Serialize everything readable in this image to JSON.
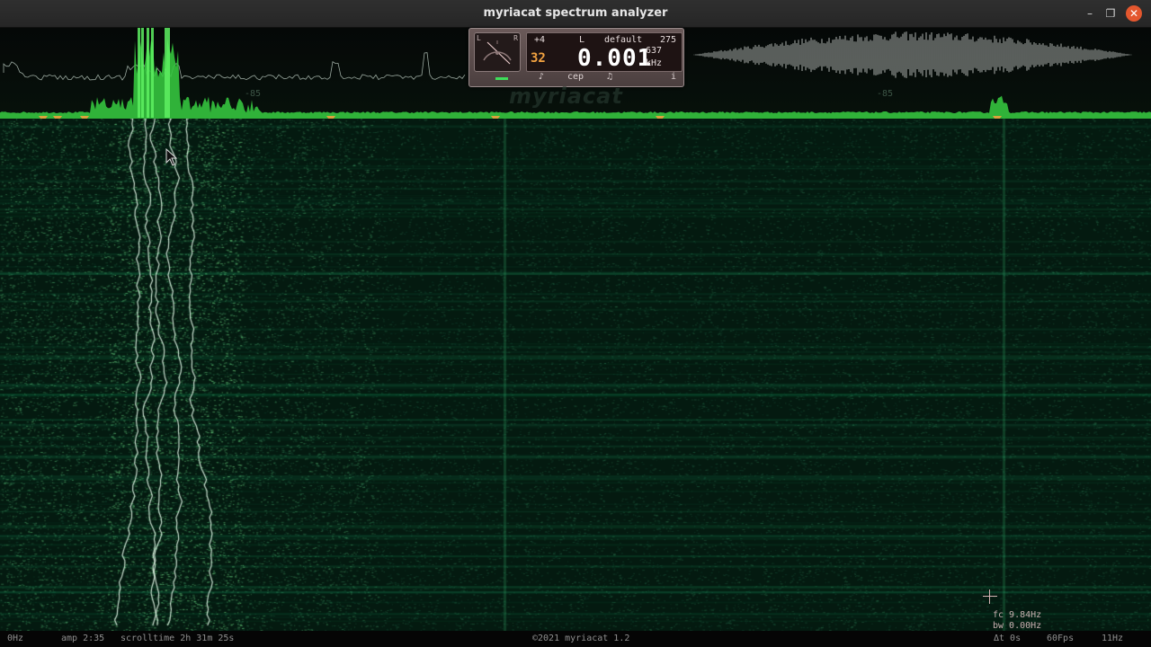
{
  "window": {
    "title": "myriacat spectrum analyzer",
    "buttons": {
      "minimize": "–",
      "maximize": "❐",
      "close": "✕"
    }
  },
  "spectrum": {
    "db_left": "-85",
    "db_right": "-85",
    "peak_marker_count": 7
  },
  "tuner": {
    "dial_left": "L",
    "dial_right": "R",
    "offset": "+4",
    "channel": "L",
    "preset": "default",
    "count": "275",
    "octave": "32",
    "frequency": "0.001",
    "cents": "637",
    "unit": "kHz",
    "tabs": {
      "note1": "♪",
      "cep": "cep",
      "note2": "♫",
      "info": "i"
    }
  },
  "brand": "myriacat",
  "cursor": {
    "fc": "fc 9.84Hz",
    "bw": "bw 0.00Hz"
  },
  "status": {
    "hz": "0Hz",
    "amp": "amp 2:35",
    "scrolltime": "scrolltime 2h 31m 25s",
    "copyright": "©2021 myriacat 1.2",
    "dt": "Δt 0s",
    "fps": "60Fps",
    "res": "11Hz"
  },
  "colors": {
    "accent_green": "#3bd646",
    "peak_marker": "#d9a23c",
    "waterfall_bg": "#041a10"
  }
}
